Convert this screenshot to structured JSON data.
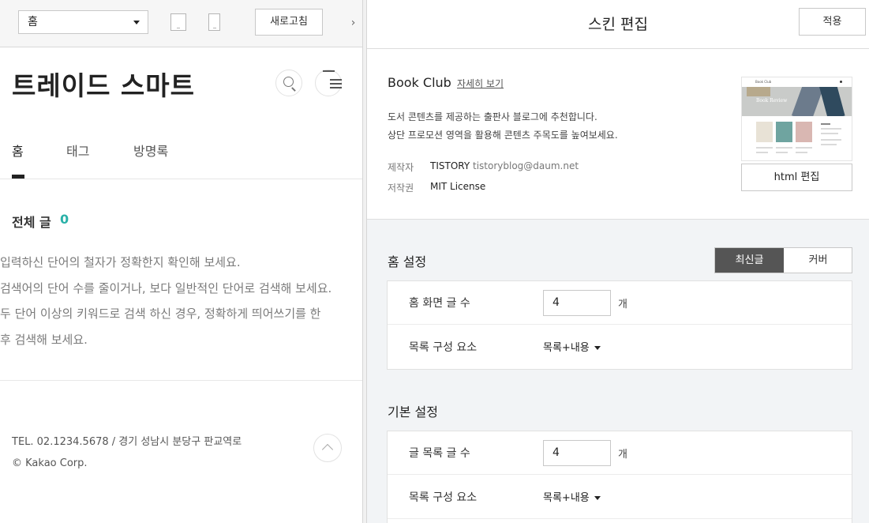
{
  "preview": {
    "page_select": "홈",
    "refresh_label": "새로고침",
    "collapse_icon": "›",
    "blog_title": "트레이드 스마트",
    "nav": [
      "홈",
      "태그",
      "방명록"
    ],
    "post_count_label": "전체 글",
    "post_count": "0",
    "guide_lines": [
      "입력하신 단어의 철자가 정확한지 확인해 보세요.",
      "검색어의 단어 수를 줄이거나, 보다 일반적인 단어로 검색해 보세요.",
      "두 단어 이상의 키워드로 검색 하신 경우, 정확하게 띄어쓰기를 한",
      "후 검색해 보세요."
    ],
    "footer_contact": "TEL. 02.1234.5678 / 경기 성남시 분당구 판교역로",
    "footer_copy": "© Kakao Corp."
  },
  "editor": {
    "title": "스킨 편집",
    "apply_label": "적용",
    "skin": {
      "name": "Book Club",
      "detail_link": "자세히 보기",
      "description": [
        "도서 콘텐츠를 제공하는 출판사 블로그에 추천합니다.",
        "상단 프로모션 영역을 활용해 콘텐츠 주목도를 높여보세요."
      ],
      "maker_label": "제작자",
      "maker": "TISTORY",
      "maker_email": "tistoryblog@daum.net",
      "license_label": "저작권",
      "license": "MIT License",
      "thumb_bar_text": "Book Club",
      "thumb_hero_text": "Book Review",
      "html_edit_label": "html 편집"
    },
    "home_settings": {
      "title": "홈 설정",
      "mode_options": [
        "최신글",
        "커버"
      ],
      "mode_selected": "최신글",
      "rows": [
        {
          "label": "홈 화면 글 수",
          "value": "4",
          "unit": "개"
        },
        {
          "label": "목록 구성 요소",
          "value": "목록+내용"
        }
      ]
    },
    "basic_settings": {
      "title": "기본 설정",
      "rows": [
        {
          "label": "글 목록 글 수",
          "value": "4",
          "unit": "개"
        },
        {
          "label": "목록 구성 요소",
          "value": "목록+내용"
        }
      ]
    }
  },
  "colors": {
    "accent": "#2ab1a8",
    "segment_active": "#555555",
    "editor_bg": "#f2f4f6"
  },
  "icons": [
    "chevron-down-icon",
    "tablet-icon",
    "mobile-icon",
    "chevron-right-icon",
    "search-icon",
    "hamburger-menu-icon",
    "chevron-up-icon"
  ]
}
